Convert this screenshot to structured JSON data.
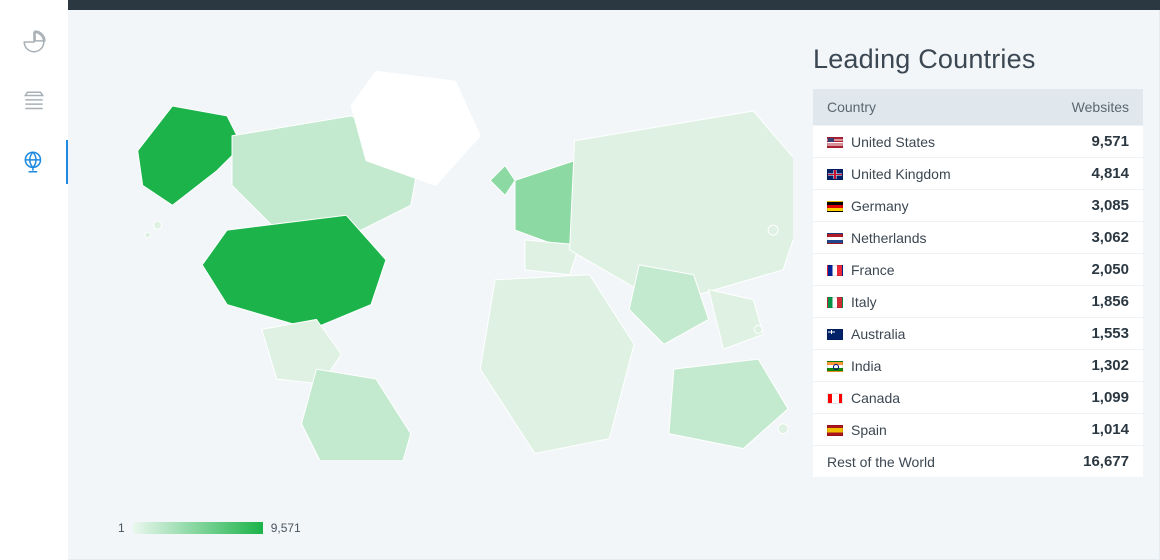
{
  "sidebar": {
    "items": [
      {
        "name": "pie-chart-icon"
      },
      {
        "name": "stack-icon"
      },
      {
        "name": "globe-icon",
        "active": true
      }
    ]
  },
  "panel": {
    "title": "Leading Countries",
    "columns": {
      "country": "Country",
      "websites": "Websites"
    },
    "rows": [
      {
        "flag": "us",
        "label": "United States",
        "value": "9,571"
      },
      {
        "flag": "gb",
        "label": "United Kingdom",
        "value": "4,814"
      },
      {
        "flag": "de",
        "label": "Germany",
        "value": "3,085"
      },
      {
        "flag": "nl",
        "label": "Netherlands",
        "value": "3,062"
      },
      {
        "flag": "fr",
        "label": "France",
        "value": "2,050"
      },
      {
        "flag": "it",
        "label": "Italy",
        "value": "1,856"
      },
      {
        "flag": "au",
        "label": "Australia",
        "value": "1,553"
      },
      {
        "flag": "in",
        "label": "India",
        "value": "1,302"
      },
      {
        "flag": "ca",
        "label": "Canada",
        "value": "1,099"
      },
      {
        "flag": "es",
        "label": "Spain",
        "value": "1,014"
      }
    ],
    "rest": {
      "label": "Rest of the World",
      "value": "16,677"
    }
  },
  "legend": {
    "min": "1",
    "max": "9,571"
  },
  "chart_data": {
    "type": "choropleth",
    "title": "Leading Countries",
    "value_label": "Websites",
    "scale": {
      "min": 1,
      "max": 9571,
      "colors": [
        "#eaf7ee",
        "#1bb34a"
      ]
    },
    "data": [
      {
        "country": "United States",
        "iso": "US",
        "websites": 9571
      },
      {
        "country": "United Kingdom",
        "iso": "GB",
        "websites": 4814
      },
      {
        "country": "Germany",
        "iso": "DE",
        "websites": 3085
      },
      {
        "country": "Netherlands",
        "iso": "NL",
        "websites": 3062
      },
      {
        "country": "France",
        "iso": "FR",
        "websites": 2050
      },
      {
        "country": "Italy",
        "iso": "IT",
        "websites": 1856
      },
      {
        "country": "Australia",
        "iso": "AU",
        "websites": 1553
      },
      {
        "country": "India",
        "iso": "IN",
        "websites": 1302
      },
      {
        "country": "Canada",
        "iso": "CA",
        "websites": 1099
      },
      {
        "country": "Spain",
        "iso": "ES",
        "websites": 1014
      }
    ],
    "rest_of_world": 16677
  }
}
